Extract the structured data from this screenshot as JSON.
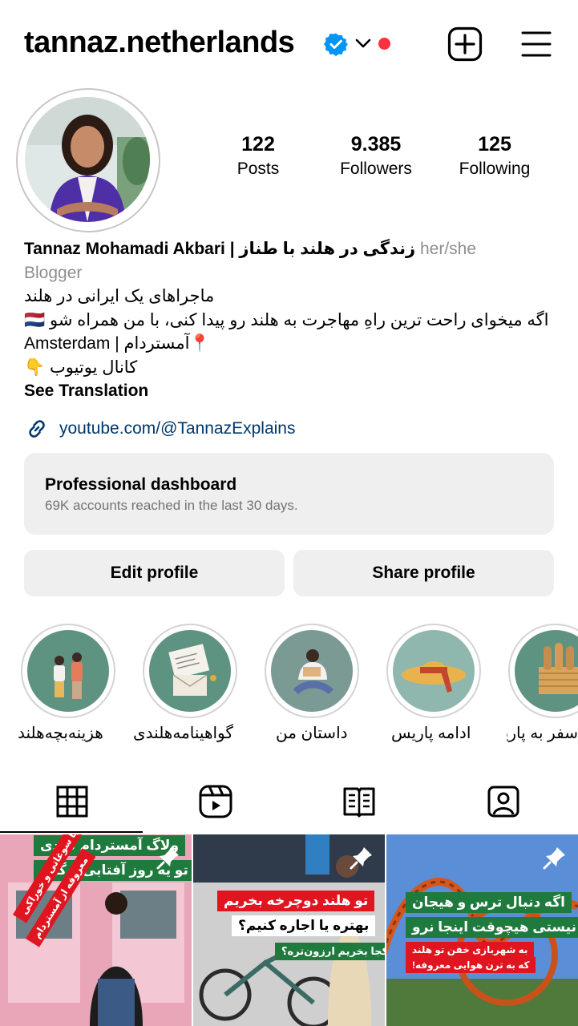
{
  "header": {
    "username": "tannaz.netherlands",
    "verified": true,
    "notification_dot": true
  },
  "stats": {
    "posts_value": "122",
    "posts_label": "Posts",
    "followers_value": "9.385",
    "followers_label": "Followers",
    "following_value": "125",
    "following_label": "Following"
  },
  "bio": {
    "name": "Tannaz Mohamadi Akbari | زندگی در هلند با طناز",
    "pronouns": "her/she",
    "category": "Blogger",
    "line1": "ماجراهای یک ایرانی در هلند",
    "line2": "اگه میخوای راحت ترین راهِ مهاجرت به هلند رو پیدا کنی، با من همراه شو 🇳🇱",
    "line3": "Amsterdam | آمستردام📍",
    "line4": "کانال یوتیوب 👇",
    "see_translation": "See Translation",
    "link": "youtube.com/@TannazExplains"
  },
  "dashboard": {
    "title": "Professional dashboard",
    "subtitle": "69K accounts reached in the last 30 days."
  },
  "buttons": {
    "edit": "Edit profile",
    "share": "Share profile"
  },
  "highlights": [
    {
      "label": "هزینه‌بچه‌هلند"
    },
    {
      "label": "گواهینامه‌هلندی"
    },
    {
      "label": "داستان من"
    },
    {
      "label": "ادامه پاریس"
    },
    {
      "label": "سفر به پاریس"
    }
  ],
  "tabs": [
    "grid-icon",
    "reels-icon",
    "guides-icon",
    "tagged-icon"
  ],
  "posts": [
    {
      "cap1": "ولاگ آمستردام گردی",
      "cap2": "تو یه روز آفتابی و گرم",
      "cap3": "با سوغاتی و خوراکی",
      "cap4": "معروفه از آمستردام"
    },
    {
      "cap1": "تو هلند دوچرخه بخریم",
      "cap2": "بهتره یا اجاره کنیم؟",
      "cap3": "از کجا بخریم ارزون‌تره؟"
    },
    {
      "cap1": "اگه دنبال ترس و هیجان",
      "cap2": "نیستی هیچوقت اینجا نرو",
      "cap3": "به شهربازی خفن تو هلند",
      "cap4": "که به ترن هوایی معروفه!"
    }
  ],
  "colors": {
    "accent_red": "#ff3040",
    "verified_blue": "#0095f6",
    "link_blue": "#00376b",
    "highlight_green": "#5f9381",
    "caption_green": "#1f7a3d",
    "caption_red": "#e0151f"
  }
}
